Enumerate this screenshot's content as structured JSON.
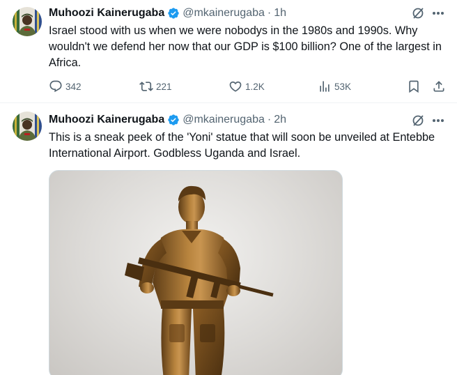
{
  "tweets": [
    {
      "author": {
        "name": "Muhoozi Kainerugaba",
        "handle": "@mkainerugaba",
        "verified": true,
        "avatar": "avatar-man-in-uniform"
      },
      "time": "1h",
      "separator": "·",
      "text": "Israel stood with us when we were nobodys in the 1980s and 1990s. Why wouldn't we defend her now that our GDP is $100 billion? One of the largest in Africa.",
      "stats": {
        "replies": "342",
        "reposts": "221",
        "likes": "1.2K",
        "views": "53K"
      }
    },
    {
      "author": {
        "name": "Muhoozi Kainerugaba",
        "handle": "@mkainerugaba",
        "verified": true,
        "avatar": "avatar-man-in-uniform"
      },
      "time": "2h",
      "separator": "·",
      "text": "This is a sneak peek of the 'Yoni' statue that will soon be unveiled at Entebbe International Airport. Godbless Uganda and Israel.",
      "media": {
        "type": "image",
        "subject": "bronze statue of soldier holding rifle"
      }
    }
  ],
  "icons": {
    "reply": "speech-bubble-icon",
    "repost": "repost-arrows-icon",
    "like": "heart-icon",
    "views": "bar-chart-icon",
    "bookmark": "bookmark-icon",
    "share": "upload-share-icon",
    "grok": "grok-icon",
    "more": "more-dots-icon",
    "verified": "verified-badge-icon"
  },
  "colors": {
    "text_primary": "#0f1419",
    "text_secondary": "#536471",
    "verified_blue": "#1d9bf0",
    "divider": "#eff3f4",
    "bronze": "#9a6a2c"
  }
}
